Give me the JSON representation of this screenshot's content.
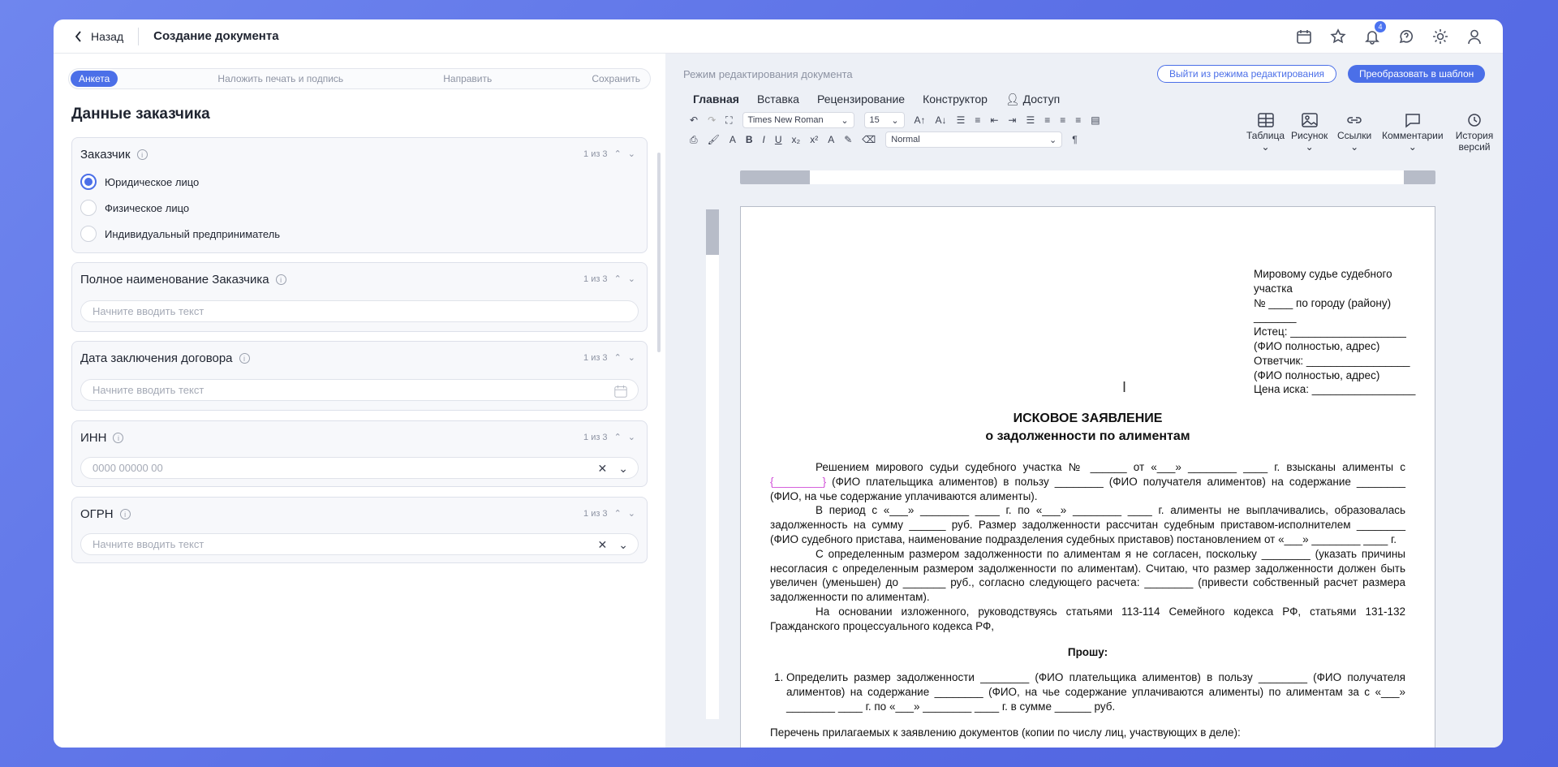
{
  "header": {
    "back": "Назад",
    "title": "Создание документа",
    "notif_count": "4"
  },
  "steps": [
    "Анкета",
    "Наложить печать и подпись",
    "Направить",
    "Сохранить"
  ],
  "section_title": "Данные заказчика",
  "cards": {
    "customer": {
      "label": "Заказчик",
      "counter": "1 из 3",
      "options": [
        "Юридическое лицо",
        "Физическое лицо",
        "Индивидуальный предприниматель"
      ],
      "selected": "Юридическое лицо"
    },
    "fullname": {
      "label": "Полное наименование Заказчика",
      "counter": "1 из 3",
      "placeholder": "Начните вводить текст"
    },
    "date": {
      "label": "Дата заключения договора",
      "counter": "1 из 3",
      "placeholder": "Начните вводить текст"
    },
    "inn": {
      "label": "ИНН",
      "counter": "1 из 3",
      "placeholder": "0000 00000 00"
    },
    "ogrn": {
      "label": "ОГРН",
      "counter": "1 из 3",
      "placeholder": "Начните вводить текст"
    }
  },
  "editor": {
    "mode": "Режим редактирования документа",
    "exit": "Выйти из режима редактирования",
    "template": "Преобразовать в шаблон",
    "menu": [
      "Главная",
      "Вставка",
      "Рецензирование",
      "Конструктор",
      "Доступ"
    ],
    "font": "Times New Roman",
    "size": "15",
    "style": "Normal",
    "big": [
      "Таблица",
      "Рисунок",
      "Ссылки",
      "Комментарии",
      "История версий"
    ]
  },
  "doc": {
    "addr": [
      "Мировому судье судебного участка",
      "№ ____ по городу (району) _______",
      "Истец: ___________________",
      "(ФИО полностью, адрес)",
      "Ответчик: _________________",
      "(ФИО полностью, адрес)",
      "Цена иска: _________________"
    ],
    "title1": "ИСКОВОЕ ЗАЯВЛЕНИЕ",
    "title2": "о задолженности по алиментам",
    "p1a": "Решением мирового судьи судебного участка № ______ от «___» ________ ____ г. взысканы алименты с ",
    "p1pink": "{________}",
    "p1b": " (ФИО плательщика алиментов) в пользу ________ (ФИО получателя алиментов) на содержание ________ (ФИО, на чье содержание уплачиваются алименты).",
    "p2": "В период с «___» ________ ____ г. по «___» ________ ____ г. алименты не выплачивались, образовалась задолженность на сумму ______ руб. Размер задолженности рассчитан судебным приставом-исполнителем ________ (ФИО судебного пристава, наименование подразделения судебных приставов) постановлением от «___» ________ ____ г.",
    "p3": "С определенным размером задолженности по алиментам я не согласен, поскольку ________ (указать причины несогласия с определенным размером задолженности по алиментам). Считаю, что размер задолженности должен быть увеличен (уменьшен) до _______ руб., согласно следующего расчета: ________ (привести собственный расчет размера задолженности по алиментам).",
    "p4": "На основании изложенного, руководствуясь статьями 113-114 Семейного кодекса РФ, статьями 131-132 Гражданского процессуального кодекса РФ,",
    "ask": "Прошу:",
    "li1": "Определить размер задолженности ________ (ФИО плательщика алиментов) в пользу ________ (ФИО получателя алиментов) на содержание ________ (ФИО, на чье содержание уплачиваются алименты) по алиментам за с «___» ________ ____ г. по «___» ________ ____ г. в сумме ______ руб.",
    "list_title": "Перечень прилагаемых к заявлению документов (копии по числу лиц, участвующих в деле):"
  }
}
